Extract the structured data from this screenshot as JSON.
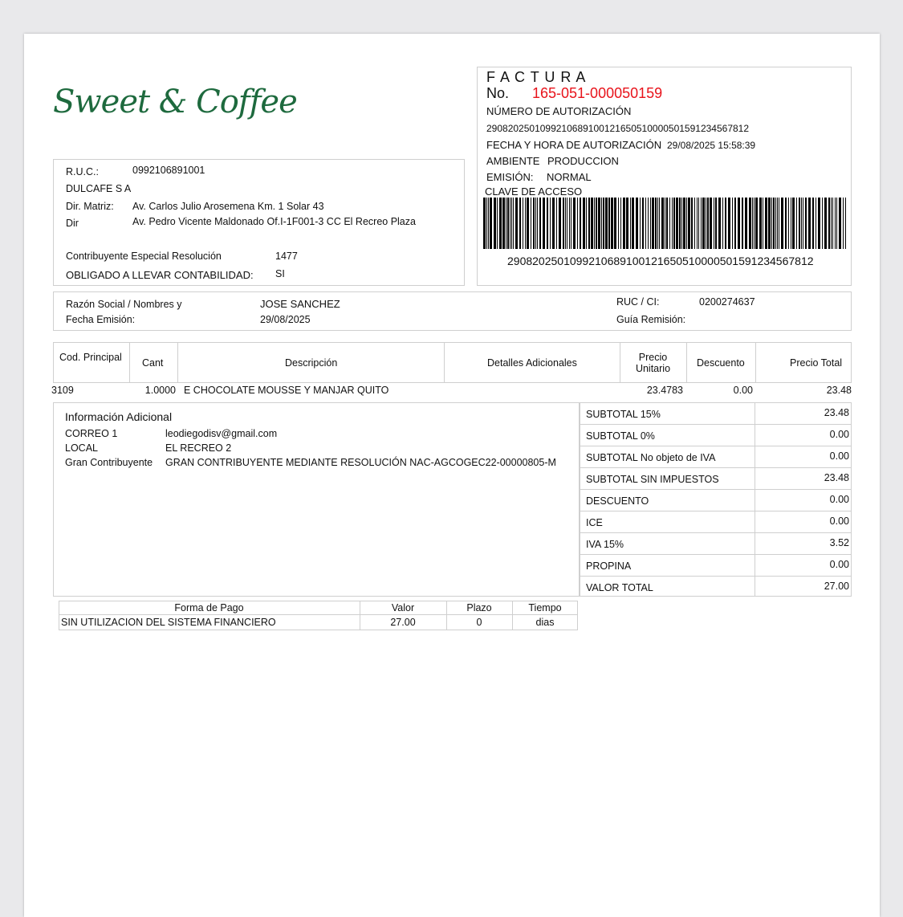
{
  "brand": {
    "logo_text": "Sweet & Coffee"
  },
  "factura": {
    "title": "F A C T U R A",
    "no_label": "No.",
    "number": "165-051-000050159",
    "auth_label": "NÚMERO DE AUTORIZACIÓN",
    "auth_number": "2908202501099210689100121650510000501591234567812",
    "auth_datetime_label": "FECHA Y HORA DE AUTORIZACIÓN",
    "auth_datetime": "29/08/2025 15:58:39",
    "ambiente_label": "AMBIENTE",
    "ambiente": "PRODUCCION",
    "emision_label": "EMISIÓN:",
    "emision": "NORMAL",
    "clave_label": "CLAVE DE ACCESO",
    "clave": "2908202501099210689100121650510000501591234567812"
  },
  "issuer": {
    "ruc_label": "R.U.C.:",
    "ruc": "0992106891001",
    "name": "DULCAFE S A",
    "matriz_label": "Dir. Matriz:",
    "matriz": "Av. Carlos Julio Arosemena Km. 1 Solar 43",
    "dir_label": "Dir",
    "dir": "Av. Pedro Vicente Maldonado Of.I-1F001-3 CC El Recreo Plaza",
    "contrib_label": "Contribuyente Especial Resolución",
    "contrib": "1477",
    "obligado_label": "OBLIGADO A LLEVAR CONTABILIDAD:",
    "obligado": "SI"
  },
  "customer": {
    "razon_label": "Razón Social / Nombres y",
    "razon": "JOSE SANCHEZ",
    "fecha_label": "Fecha Emisión:",
    "fecha": "29/08/2025",
    "ruc_label": "RUC / CI:",
    "ruc": "0200274637",
    "guia_label": "Guía Remisión:"
  },
  "items_table": {
    "headers": {
      "cod": "Cod. Principal",
      "cant": "Cant",
      "desc": "Descripción",
      "detalles": "Detalles Adicionales",
      "precio_1": "Precio",
      "precio_2": "Unitario",
      "descuento": "Descuento",
      "total": "Precio Total"
    },
    "rows": [
      {
        "cod": "3109",
        "cant": "1.0000",
        "desc": "E CHOCOLATE MOUSSE Y MANJAR QUITO",
        "precio": "23.4783",
        "descuento": "0.00",
        "total": "23.48"
      }
    ]
  },
  "info_adicional": {
    "title": "Información Adicional",
    "correo_label": "CORREO 1",
    "correo": "leodiegodisv@gmail.com",
    "local_label": "LOCAL",
    "local": "EL RECREO 2",
    "gran_label": "Gran Contribuyente",
    "gran": "GRAN CONTRIBUYENTE MEDIANTE RESOLUCIÓN NAC-AGCOGEC22-00000805-M"
  },
  "totals": [
    {
      "label": "SUBTOTAL 15%",
      "value": "23.48"
    },
    {
      "label": "SUBTOTAL 0%",
      "value": "0.00"
    },
    {
      "label": "SUBTOTAL No objeto de IVA",
      "value": "0.00"
    },
    {
      "label": "SUBTOTAL SIN IMPUESTOS",
      "value": "23.48"
    },
    {
      "label": "DESCUENTO",
      "value": "0.00"
    },
    {
      "label": "ICE",
      "value": "0.00"
    },
    {
      "label": "IVA 15%",
      "value": "3.52"
    },
    {
      "label": "PROPINA",
      "value": "0.00"
    },
    {
      "label": "VALOR TOTAL",
      "value": "27.00"
    }
  ],
  "payment": {
    "headers": {
      "forma": "Forma de Pago",
      "valor": "Valor",
      "plazo": "Plazo",
      "tiempo": "Tiempo"
    },
    "row": {
      "forma": "SIN UTILIZACION DEL SISTEMA FINANCIERO",
      "valor": "27.00",
      "plazo": "0",
      "tiempo": "dias"
    }
  }
}
